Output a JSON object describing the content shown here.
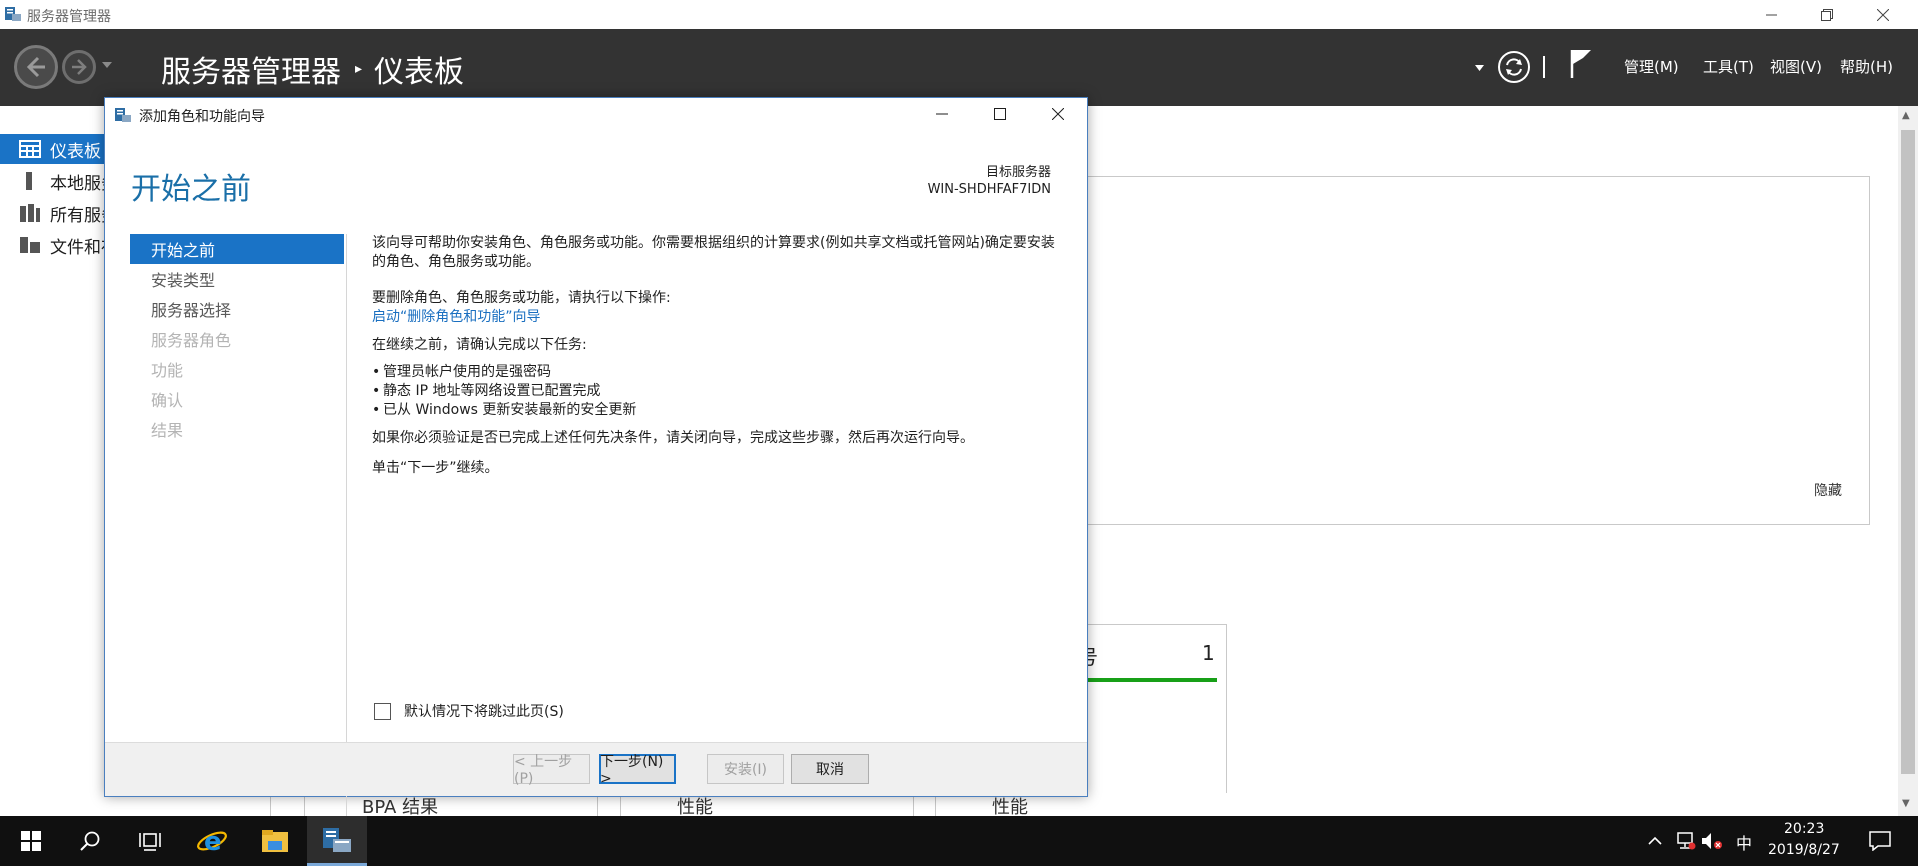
{
  "window": {
    "title": "服务器管理器"
  },
  "header": {
    "breadcrumb_root": "服务器管理器",
    "breadcrumb_sep": "▸",
    "breadcrumb_current": "仪表板",
    "menus": [
      "管理(M)",
      "工具(T)",
      "视图(V)",
      "帮助(H)"
    ]
  },
  "sidebar": {
    "items": [
      {
        "label": "仪表板",
        "icon": "dashboard-icon"
      },
      {
        "label": "本地服务器",
        "icon": "server-icon"
      },
      {
        "label": "所有服务器",
        "icon": "servers-icon"
      },
      {
        "label": "文件和存储服务",
        "icon": "storage-icon"
      }
    ]
  },
  "main": {
    "hide_label": "隐藏",
    "tile_fragment": "号",
    "tile_count": "1",
    "bottom_cells": [
      "BPA 结果",
      "性能",
      "性能"
    ]
  },
  "dialog": {
    "title": "添加角色和功能向导",
    "heading": "开始之前",
    "target_label": "目标服务器",
    "target_server": "WIN-SHDHFAF7IDN",
    "steps": [
      {
        "label": "开始之前",
        "state": "active"
      },
      {
        "label": "安装类型",
        "state": "enabled"
      },
      {
        "label": "服务器选择",
        "state": "enabled"
      },
      {
        "label": "服务器角色",
        "state": "disabled"
      },
      {
        "label": "功能",
        "state": "disabled"
      },
      {
        "label": "确认",
        "state": "disabled"
      },
      {
        "label": "结果",
        "state": "disabled"
      }
    ],
    "content": {
      "intro": "该向导可帮助你安装角色、角色服务或功能。你需要根据组织的计算要求(例如共享文档或托管网站)确定要安装的角色、角色服务或功能。",
      "remove_intro": "要删除角色、角色服务或功能，请执行以下操作:",
      "remove_link": "启动“删除角色和功能”向导",
      "before_continue": "在继续之前，请确认完成以下任务:",
      "tasks": [
        "管理员帐户使用的是强密码",
        "静态 IP 地址等网络设置已配置完成",
        "已从 Windows 更新安装最新的安全更新"
      ],
      "verify_note": "如果你必须验证是否已完成上述任何先决条件，请关闭向导，完成这些步骤，然后再次运行向导。",
      "next_note": "单击“下一步”继续。"
    },
    "skip_checkbox_label": "默认情况下将跳过此页(S)",
    "skip_checked": false,
    "buttons": {
      "previous": "< 上一步(P)",
      "next": "下一步(N) >",
      "install": "安装(I)",
      "cancel": "取消"
    }
  },
  "taskbar": {
    "ime": "中",
    "time": "20:23",
    "date": "2019/8/27"
  },
  "colors": {
    "accent": "#1a73c6",
    "header_bg": "#333333",
    "heading_blue": "#1a6fa8",
    "status_green": "#18a018"
  }
}
